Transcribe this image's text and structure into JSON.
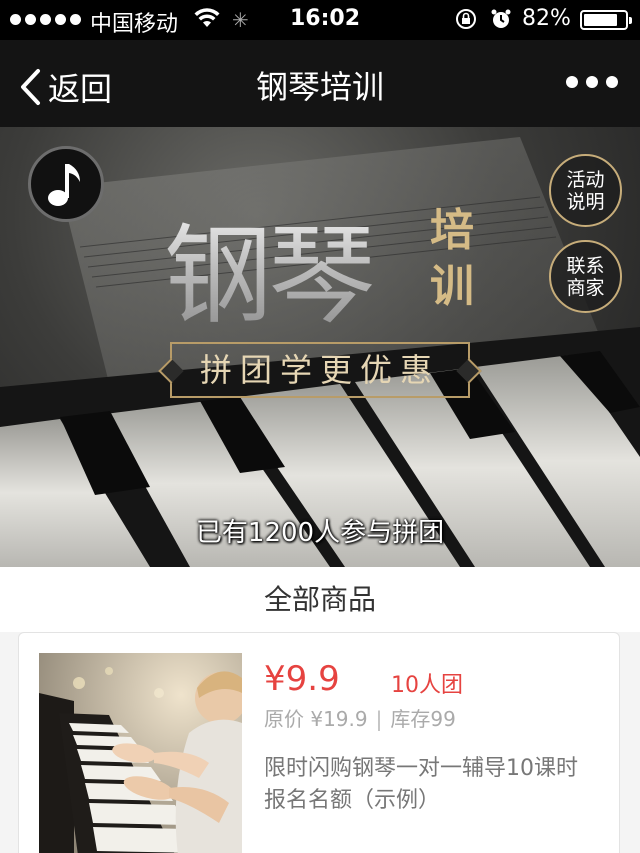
{
  "status_bar": {
    "carrier": "中国移动",
    "time": "16:02",
    "battery": "82%",
    "battery_level": 0.82
  },
  "nav": {
    "back_label": "返回",
    "title": "钢琴培训"
  },
  "banner": {
    "title_main": "钢琴",
    "title_side": "培训",
    "slogan": "拼团学更优惠",
    "joined_text": "已有1200人参与拼团",
    "buttons": {
      "activity_line1": "活动",
      "activity_line2": "说明",
      "contact_line1": "联系",
      "contact_line2": "商家"
    }
  },
  "section": {
    "title": "全部商品"
  },
  "products": [
    {
      "price": "¥9.9",
      "group_size": "10人团",
      "original_price": "原价 ¥19.9",
      "stock": "库存99",
      "name": "限时闪购钢琴一对一辅导10课时报名名额（示例）"
    }
  ],
  "colors": {
    "accent_red": "#e64340",
    "gold": "#c7ad7a",
    "nav_bg": "#141414"
  }
}
